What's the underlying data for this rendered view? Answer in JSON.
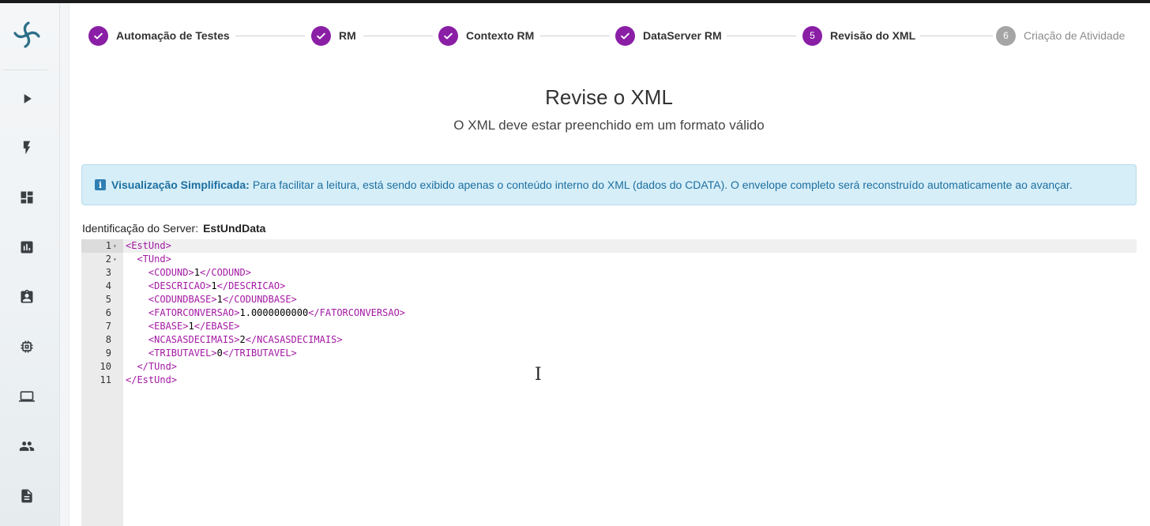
{
  "stepper": {
    "steps": [
      {
        "label": "Automação de Testes",
        "state": "done"
      },
      {
        "label": "RM",
        "state": "done"
      },
      {
        "label": "Contexto RM",
        "state": "done"
      },
      {
        "label": "DataServer RM",
        "state": "done"
      },
      {
        "label": "Revisão do XML",
        "state": "active",
        "number": "5"
      },
      {
        "label": "Criação de Atividade",
        "state": "pending",
        "number": "6"
      }
    ]
  },
  "header": {
    "title": "Revise o XML",
    "subtitle": "O XML deve estar preenchido em um formato válido"
  },
  "alert": {
    "strong": "Visualização Simplificada:",
    "text": "Para facilitar a leitura, está sendo exibido apenas o conteúdo interno do XML (dados do CDATA). O envelope completo será reconstruído automaticamente ao avançar.",
    "icon": "info-icon"
  },
  "server": {
    "label": "Identificação do Server:",
    "value": "EstUndData"
  },
  "editor": {
    "lines": [
      {
        "n": "1",
        "fold": true,
        "indent": "",
        "open": "EstUnd",
        "value": "",
        "close": ""
      },
      {
        "n": "2",
        "fold": true,
        "indent": "  ",
        "open": "TUnd",
        "value": "",
        "close": ""
      },
      {
        "n": "3",
        "fold": false,
        "indent": "    ",
        "open": "CODUND",
        "value": "1",
        "close": "CODUND"
      },
      {
        "n": "4",
        "fold": false,
        "indent": "    ",
        "open": "DESCRICAO",
        "value": "1",
        "close": "DESCRICAO"
      },
      {
        "n": "5",
        "fold": false,
        "indent": "    ",
        "open": "CODUNDBASE",
        "value": "1",
        "close": "CODUNDBASE"
      },
      {
        "n": "6",
        "fold": false,
        "indent": "    ",
        "open": "FATORCONVERSAO",
        "value": "1.0000000000",
        "close": "FATORCONVERSAO"
      },
      {
        "n": "7",
        "fold": false,
        "indent": "    ",
        "open": "EBASE",
        "value": "1",
        "close": "EBASE"
      },
      {
        "n": "8",
        "fold": false,
        "indent": "    ",
        "open": "NCASASDECIMAIS",
        "value": "2",
        "close": "NCASASDECIMAIS"
      },
      {
        "n": "9",
        "fold": false,
        "indent": "    ",
        "open": "TRIBUTAVEL",
        "value": "0",
        "close": "TRIBUTAVEL"
      },
      {
        "n": "10",
        "fold": false,
        "indent": "  ",
        "open": "",
        "value": "",
        "close": "TUnd"
      },
      {
        "n": "11",
        "fold": false,
        "indent": "",
        "open": "",
        "value": "",
        "close": "EstUnd"
      }
    ]
  },
  "sidebar": {
    "icons": [
      "play-icon",
      "bolt-icon",
      "dashboard-icon",
      "chart-icon",
      "clipboard-icon",
      "chip-icon",
      "laptop-icon",
      "people-icon",
      "document-icon"
    ]
  },
  "colors": {
    "accent": "#8a1fa6",
    "xml_tag": "#a319a3",
    "alert_bg": "#d6eef8",
    "alert_text": "#1d6fa0"
  }
}
